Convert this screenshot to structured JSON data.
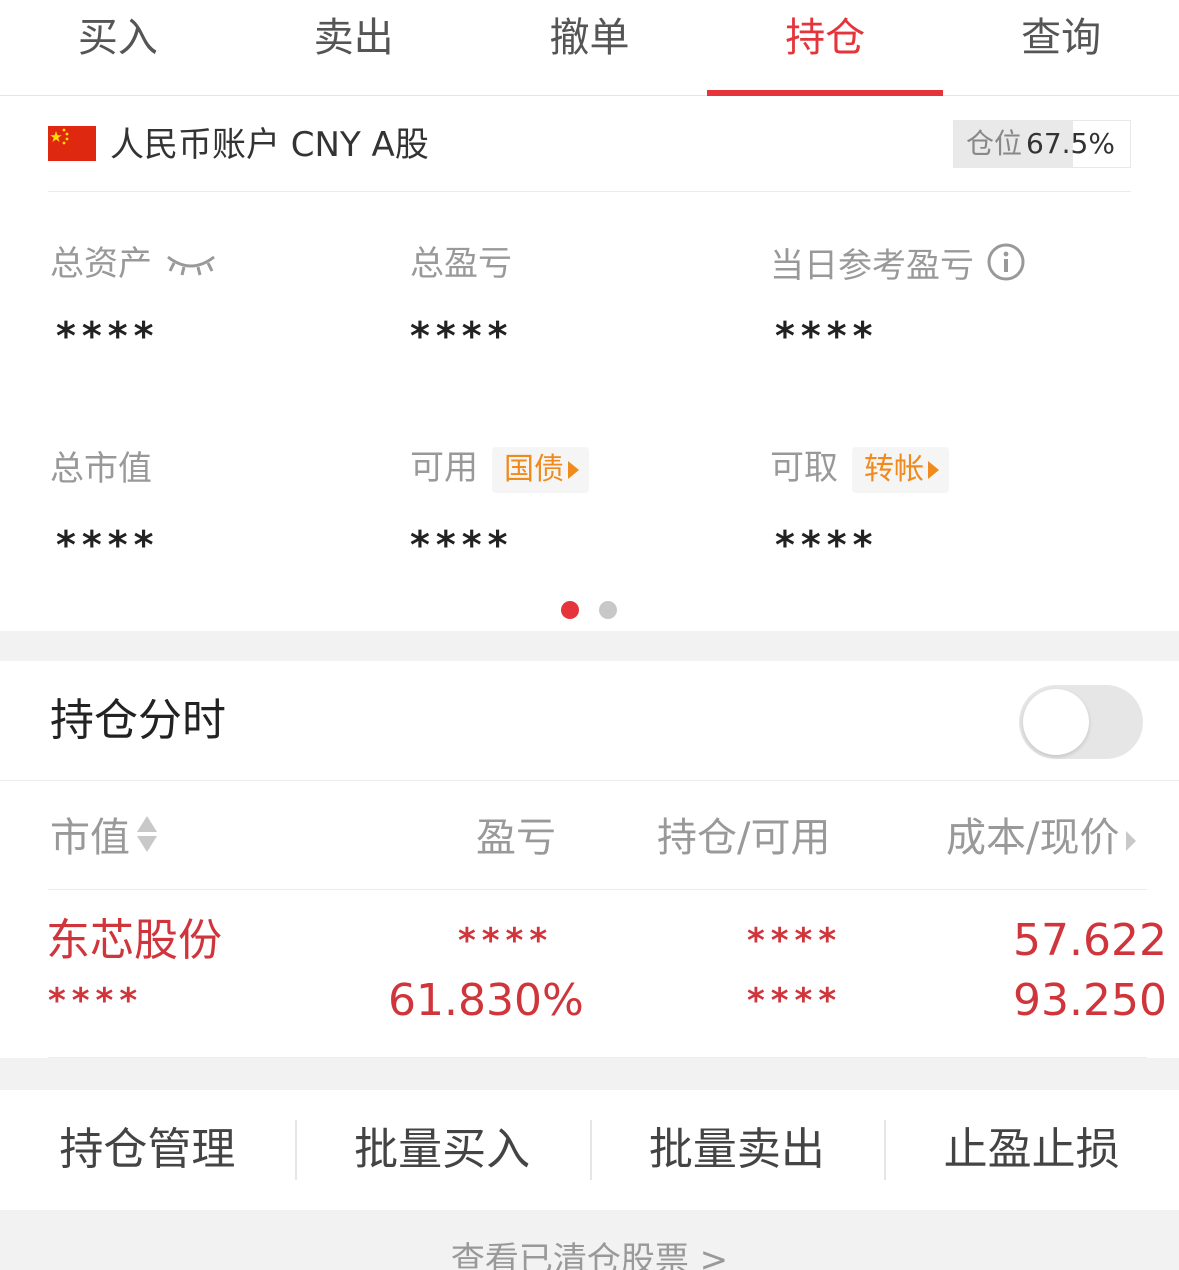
{
  "tabs": [
    "买入",
    "卖出",
    "撤单",
    "持仓",
    "查询"
  ],
  "active_tab": "持仓",
  "account": {
    "flag_icon": "china-flag-icon",
    "name": "人民币账户 CNY A股",
    "position_label": "仓位",
    "position_value": "67.5%",
    "position_fraction": 0.675
  },
  "stats": {
    "total_assets_label": "总资产",
    "total_assets_value": "****",
    "total_pl_label": "总盈亏",
    "total_pl_value": "****",
    "daily_pl_label": "当日参考盈亏",
    "daily_pl_value": "****",
    "market_value_label": "总市值",
    "market_value_value": "****",
    "available_label": "可用",
    "available_chip": "国债",
    "available_value": "****",
    "withdrawable_label": "可取",
    "withdrawable_chip": "转帐",
    "withdrawable_value": "****"
  },
  "pager": {
    "pages": 2,
    "active": 1
  },
  "timeshare": {
    "title": "持仓分时",
    "toggle_on": false
  },
  "table": {
    "headers": {
      "market_value": "市值",
      "pl": "盈亏",
      "holding": "持仓/可用",
      "cost": "成本/现价"
    },
    "rows": [
      {
        "name": "东芯股份",
        "market_value": "****",
        "pl_amount": "****",
        "pl_percent": "61.830%",
        "holding": "****",
        "available": "****",
        "cost": "57.622",
        "price": "93.250"
      }
    ]
  },
  "actions": [
    "持仓管理",
    "批量买入",
    "批量卖出",
    "止盈止损"
  ],
  "footer_link": "查看已清仓股票 >",
  "colors": {
    "accent": "#e5343b",
    "chip": "#f08a1c",
    "muted": "#999999"
  }
}
